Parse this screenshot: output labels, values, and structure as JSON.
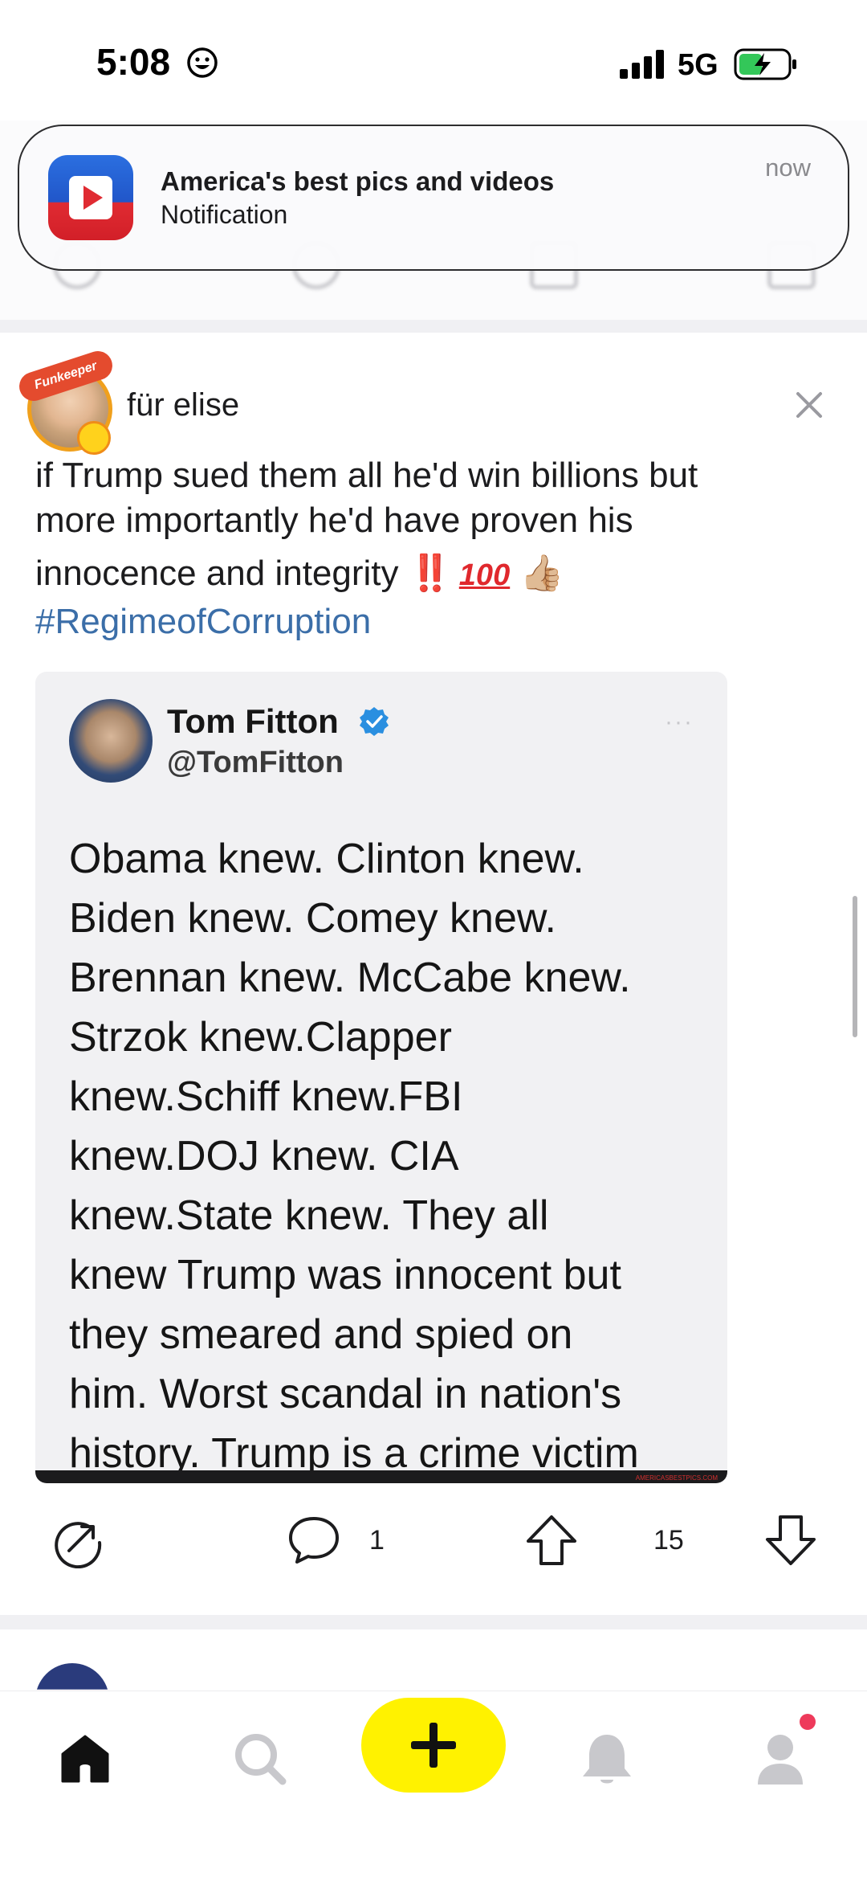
{
  "status_bar": {
    "time": "5:08",
    "network": "5G",
    "status_emoji_icon": "smiley-face-icon",
    "signal_icon": "cellular-signal-icon",
    "battery_icon": "battery-charging-icon"
  },
  "notification": {
    "app_icon": "video-play-app-icon",
    "title": "America's best pics and videos",
    "body": "Notification",
    "time": "now"
  },
  "post": {
    "author": "für elise",
    "avatar_badge": "Funkeeper",
    "dismiss_icon": "close-icon",
    "text_lines": [
      "if Trump sued them all he'd win billions but",
      "more importantly he'd have proven his",
      "innocence and integrity"
    ],
    "emoji_double_exclamation": "‼️",
    "emoji_hundred": "100",
    "emoji_thumbs_up": "👍🏼",
    "hashtag": "#RegimeofCorruption",
    "embed": {
      "name": "Tom Fitton",
      "handle": "@TomFitton",
      "menu": "···",
      "verified_icon": "verified-badge-icon",
      "lines": [
        "Obama knew. Clinton knew.",
        "Biden knew. Comey knew.",
        "Brennan knew. McCabe knew.",
        "Strzok knew.Clapper",
        "knew.Schiff knew.FBI",
        "knew.DOJ knew. CIA",
        "knew.State knew. They all",
        "knew Trump was innocent but",
        "they smeared and spied on",
        "him. Worst scandal in nation's",
        "history. Trump is a crime victim"
      ],
      "watermark": "AMERICASBESTPICS.COM"
    },
    "actions": {
      "share_icon": "share-icon",
      "comment_icon": "comment-icon",
      "comment_count": "1",
      "upvote_icon": "arrow-up-icon",
      "score": "15",
      "downvote_icon": "arrow-down-icon"
    }
  },
  "tab_bar": {
    "items": [
      {
        "name": "home",
        "icon": "home-icon",
        "active": true
      },
      {
        "name": "search",
        "icon": "search-icon",
        "active": false
      },
      {
        "name": "create",
        "icon": "plus-icon",
        "active": false
      },
      {
        "name": "notifications",
        "icon": "bell-icon",
        "active": false
      },
      {
        "name": "profile",
        "icon": "profile-icon",
        "active": false
      }
    ]
  },
  "colors": {
    "accent_yellow": "#fff200",
    "hashtag_blue": "#3b6ea8",
    "notification_red": "#ee3a5b"
  }
}
